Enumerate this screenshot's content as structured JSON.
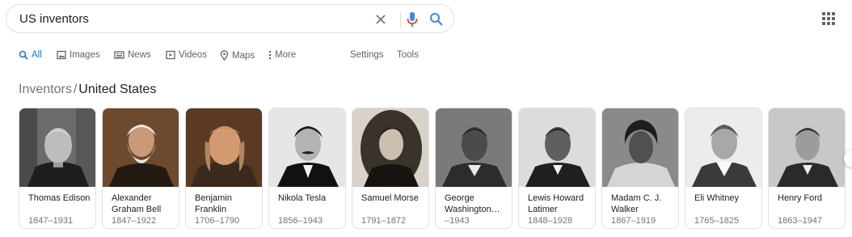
{
  "search": {
    "query": "US inventors"
  },
  "tabs": [
    {
      "label": "All",
      "icon": "search-icon",
      "active": true
    },
    {
      "label": "Images",
      "icon": "image-icon"
    },
    {
      "label": "News",
      "icon": "news-icon"
    },
    {
      "label": "Videos",
      "icon": "video-icon"
    },
    {
      "label": "Maps",
      "icon": "map-pin-icon"
    },
    {
      "label": "More",
      "icon": "more-vert-icon"
    }
  ],
  "tools": {
    "settings": "Settings",
    "tools": "Tools"
  },
  "breadcrumb": {
    "parent": "Inventors",
    "separator": "/",
    "current": "United States"
  },
  "inventors": [
    {
      "name": "Thomas Edison",
      "years": "1847–1931"
    },
    {
      "name": "Alexander Graham Bell",
      "years": "1847–1922"
    },
    {
      "name": "Benjamin Franklin",
      "years": "1706–1790"
    },
    {
      "name": "Nikola Tesla",
      "years": "1856–1943"
    },
    {
      "name": "Samuel Morse",
      "years": "1791–1872"
    },
    {
      "name": "George Washington…",
      "years": "–1943"
    },
    {
      "name": "Lewis Howard Latimer",
      "years": "1848–1928"
    },
    {
      "name": "Madam C. J. Walker",
      "years": "1867–1919"
    },
    {
      "name": "Eli Whitney",
      "years": "1765–1825"
    },
    {
      "name": "Henry Ford",
      "years": "1863–1947"
    }
  ],
  "colors": {
    "accent": "#1a73e8",
    "mic_red": "#ea4335",
    "text": "#202124",
    "muted": "#70757a"
  }
}
